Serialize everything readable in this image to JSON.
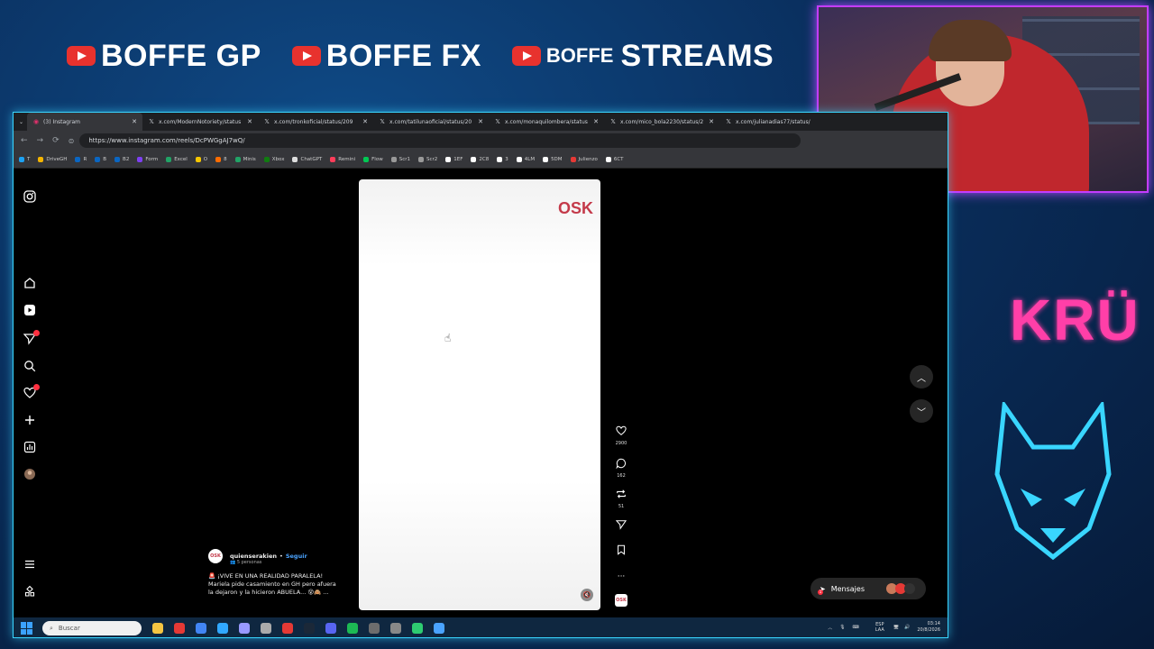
{
  "overlay": {
    "channels": [
      {
        "prefix": "",
        "name": "BOFFE GP"
      },
      {
        "prefix": "",
        "name": "BOFFE FX"
      },
      {
        "prefix": "BOFFE",
        "name": "STREAMS"
      }
    ],
    "right_logo_text": "KRÜ"
  },
  "browser": {
    "tabs": [
      {
        "icon": "instagram-icon",
        "label": "(3) Instagram"
      },
      {
        "icon": "x-icon",
        "label": "x.com/ModernNotoriety/status"
      },
      {
        "icon": "x-icon",
        "label": "x.com/tronkoficial/status/209"
      },
      {
        "icon": "x-icon",
        "label": "x.com/tatilunaoficial/status/20"
      },
      {
        "icon": "x-icon",
        "label": "x.com/monaquilombera/status"
      },
      {
        "icon": "x-icon",
        "label": "x.com/mico_bola2230/status/2"
      },
      {
        "icon": "x-icon",
        "label": "x.com/julianadias77/status/"
      }
    ],
    "url": "https://www.instagram.com/reels/DcPWGgAJ7wQ/",
    "bookmarks": [
      {
        "label": "T",
        "color": "#1da1f2"
      },
      {
        "label": "DriveGH",
        "color": "#f4b400"
      },
      {
        "label": "R",
        "color": "#0a66c2"
      },
      {
        "label": "B",
        "color": "#0a66c2"
      },
      {
        "label": "B2",
        "color": "#0a66c2"
      },
      {
        "label": "Form",
        "color": "#7e3ff2"
      },
      {
        "label": "Excel",
        "color": "#21a366"
      },
      {
        "label": "O",
        "color": "#f7c600"
      },
      {
        "label": "8",
        "color": "#ff6d00"
      },
      {
        "label": "Minis",
        "color": "#21a366"
      },
      {
        "label": "Xbox",
        "color": "#107c10"
      },
      {
        "label": "ChatGPT",
        "color": "#dddddd"
      },
      {
        "label": "Remini",
        "color": "#ff3d5a"
      },
      {
        "label": "Flow",
        "color": "#00c853"
      },
      {
        "label": "Scr1",
        "color": "#999999"
      },
      {
        "label": "Scr2",
        "color": "#999999"
      },
      {
        "label": "1EF",
        "color": "#ffffff"
      },
      {
        "label": "2C8",
        "color": "#ffffff"
      },
      {
        "label": "3",
        "color": "#ffffff"
      },
      {
        "label": "4LM",
        "color": "#ffffff"
      },
      {
        "label": "5DM",
        "color": "#ffffff"
      },
      {
        "label": "Julienzo",
        "color": "#e53935"
      },
      {
        "label": "6CT",
        "color": "#ffffff"
      }
    ]
  },
  "reel": {
    "watermark": "OSK",
    "likes": "2900",
    "comments": "162",
    "reposts": "51",
    "audio_label": "OSK",
    "user": "quienserakien",
    "separator": "•",
    "follow": "Seguir",
    "sub": "5 personas",
    "caption_line1": "🚨 ¡VIVE EN UNA REALIDAD PARALELA!",
    "caption_line2": "Mariela pide casamiento en GH pero afuera",
    "caption_line3": "la dejaron y la hicieron ABUELA... 😵🙈 ..."
  },
  "messages": {
    "label": "Mensajes",
    "badge": "1"
  },
  "taskbar": {
    "search_placeholder": "Buscar",
    "lang_top": "ESP",
    "lang_bottom": "LAA",
    "time": "03:14",
    "date": "20/8/2026",
    "apps": [
      "#f5c542",
      "#e53935",
      "#4285f4",
      "#31a8ff",
      "#9999ff",
      "#aaaaaa",
      "#e53935",
      "#1b2838",
      "#5865f2",
      "#1db954",
      "#6d6d6d",
      "#888888",
      "#2ecc71",
      "#4aa3ff"
    ]
  },
  "colors": {
    "accent_border": "#39d6ff",
    "webcam_border": "#c43cff",
    "kru_pink": "#ff3fa8",
    "wolf_cyan": "#39d6ff"
  }
}
